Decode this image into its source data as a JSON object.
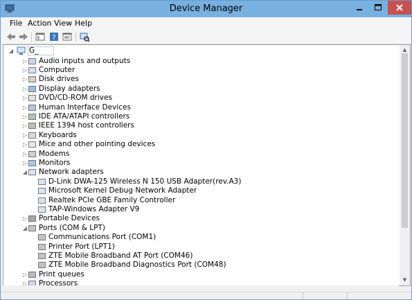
{
  "window": {
    "title": "Device Manager"
  },
  "menu": [
    "File",
    "Action",
    "View",
    "Help"
  ],
  "titlebar_buttons": {
    "minimize": "—",
    "maximize": "☐",
    "close": "✕"
  },
  "tree": {
    "root": {
      "label": "G_"
    },
    "categories": [
      {
        "label": "Audio inputs and outputs",
        "icon": "speaker-icon",
        "expanded": false
      },
      {
        "label": "Computer",
        "icon": "computer-icon",
        "expanded": false
      },
      {
        "label": "Disk drives",
        "icon": "disk-drive-icon",
        "expanded": false
      },
      {
        "label": "Display adapters",
        "icon": "display-adapter-icon",
        "expanded": false
      },
      {
        "label": "DVD/CD-ROM drives",
        "icon": "dvd-drive-icon",
        "expanded": false
      },
      {
        "label": "Human Interface Devices",
        "icon": "hid-icon",
        "expanded": false
      },
      {
        "label": "IDE ATA/ATAPI controllers",
        "icon": "ide-controller-icon",
        "expanded": false
      },
      {
        "label": "IEEE 1394 host controllers",
        "icon": "ieee1394-icon",
        "expanded": false
      },
      {
        "label": "Keyboards",
        "icon": "keyboard-icon",
        "expanded": false
      },
      {
        "label": "Mice and other pointing devices",
        "icon": "mouse-icon",
        "expanded": false
      },
      {
        "label": "Modems",
        "icon": "modem-icon",
        "expanded": false
      },
      {
        "label": "Monitors",
        "icon": "monitor-icon",
        "expanded": false
      },
      {
        "label": "Network adapters",
        "icon": "network-adapter-icon",
        "expanded": true,
        "children": [
          "D-Link DWA-125 Wireless N 150 USB Adapter(rev.A3)",
          "Microsoft Kernel Debug Network Adapter",
          "Realtek PCIe GBE Family Controller",
          "TAP-Windows Adapter V9"
        ]
      },
      {
        "label": "Portable Devices",
        "icon": "portable-device-icon",
        "expanded": false
      },
      {
        "label": "Ports (COM & LPT)",
        "icon": "port-icon",
        "expanded": true,
        "children": [
          "Communications Port (COM1)",
          "Printer Port (LPT1)",
          "ZTE Mobile Broadband AT Port (COM46)",
          "ZTE Mobile Broadband Diagnostics Port (COM48)"
        ]
      },
      {
        "label": "Print queues",
        "icon": "printer-icon",
        "expanded": false
      },
      {
        "label": "Processors",
        "icon": "processor-icon",
        "expanded": false
      }
    ]
  },
  "glyphs": {
    "collapsed": "▷",
    "expanded": "◢",
    "scroll_up": "▲",
    "scroll_down": "▼"
  },
  "colors": {
    "titlebar": "#78b0e0",
    "close_button": "#c75050",
    "selection_border": "#7a9cc7"
  }
}
